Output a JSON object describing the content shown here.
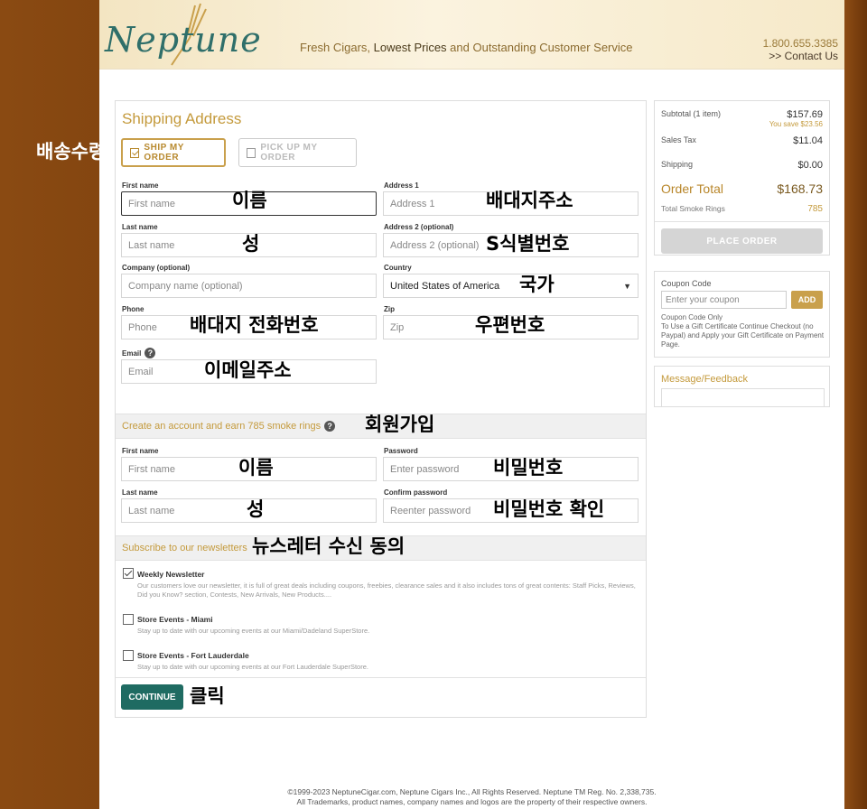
{
  "header": {
    "logo_text": "Neptune",
    "tagline_1": "Fresh Cigars, ",
    "tagline_2": "Lowest Prices",
    "tagline_3": " and Outstanding Customer Service",
    "phone": "1.800.655.3385",
    "contact": ">> Contact Us"
  },
  "shipping": {
    "title": "Shipping Address",
    "ship_btn": "SHIP MY ORDER",
    "pickup_btn": "PICK UP MY ORDER",
    "first_name_label": "First name",
    "first_name_ph": "First name",
    "last_name_label": "Last name",
    "last_name_ph": "Last name",
    "company_label": "Company (optional)",
    "company_ph": "Company name (optional)",
    "phone_label": "Phone",
    "phone_ph": "Phone",
    "email_label": "Email",
    "email_ph": "Email",
    "address1_label": "Address 1",
    "address1_ph": "Address 1",
    "address2_label": "Address 2 (optional)",
    "address2_ph": "Address 2 (optional)",
    "country_label": "Country",
    "country_value": "United States of America",
    "zip_label": "Zip",
    "zip_ph": "Zip"
  },
  "account": {
    "band_text": "Create an account and earn 785 smoke rings",
    "first_name_label": "First name",
    "first_name_ph": "First name",
    "last_name_label": "Last name",
    "last_name_ph": "Last name",
    "password_label": "Password",
    "password_ph": "Enter password",
    "confirm_label": "Confirm password",
    "confirm_ph": "Reenter password"
  },
  "newsletter": {
    "band_text": "Subscribe to our newsletters",
    "items": [
      {
        "title": "Weekly Newsletter",
        "desc": "Our customers love our newsletter, it is full of great deals including coupons, freebies, clearance sales and it also includes tons of great contents: Staff Picks, Reviews, Did you Know? section, Contests, New Arrivals, New Products....",
        "checked": true
      },
      {
        "title": "Store Events - Miami",
        "desc": "Stay up to date with our upcoming events at our Miami/Dadeland SuperStore.",
        "checked": false
      },
      {
        "title": "Store Events - Fort Lauderdale",
        "desc": "Stay up to date with our upcoming events at our Fort Lauderdale SuperStore.",
        "checked": false
      }
    ],
    "continue_btn": "CONTINUE"
  },
  "summary": {
    "subtotal_label": "Subtotal (1 item)",
    "subtotal_value": "$157.69",
    "save_text": "You save $23.56",
    "tax_label": "Sales Tax",
    "tax_value": "$11.04",
    "shipping_label": "Shipping",
    "shipping_value": "$0.00",
    "total_label": "Order Total",
    "total_value": "$168.73",
    "smoke_label": "Total Smoke Rings",
    "smoke_value": "785",
    "place_btn": "PLACE ORDER"
  },
  "coupon": {
    "label": "Coupon Code",
    "placeholder": "Enter your coupon",
    "add_btn": "ADD",
    "note": "Coupon Code Only\nTo Use a Gift Certificate Continue Checkout (no Paypal) and Apply your Gift Certificate on Payment Page."
  },
  "message": {
    "label": "Message/Feedback"
  },
  "footer": {
    "line1": "©1999-2023 NeptuneCigar.com, Neptune Cigars Inc., All Rights Reserved. Neptune TM Reg. No. 2,338,735.",
    "line2": "All Trademarks, product names, company names and logos are the property of their respective owners."
  },
  "annotations": {
    "delivery": "배송수령",
    "name": "이름",
    "surname": "성",
    "phone": "배대지 전화번호",
    "email": "이메일주소",
    "address1": "배대지주소",
    "address2": "S식별번호",
    "country": "국가",
    "zip": "우편번호",
    "signup": "회원가입",
    "acc_name": "이름",
    "acc_surname": "성",
    "password": "비밀번호",
    "password_confirm": "비밀번호 확인",
    "newsletter": "뉴스레터 수신 동의",
    "click": "클릭"
  }
}
